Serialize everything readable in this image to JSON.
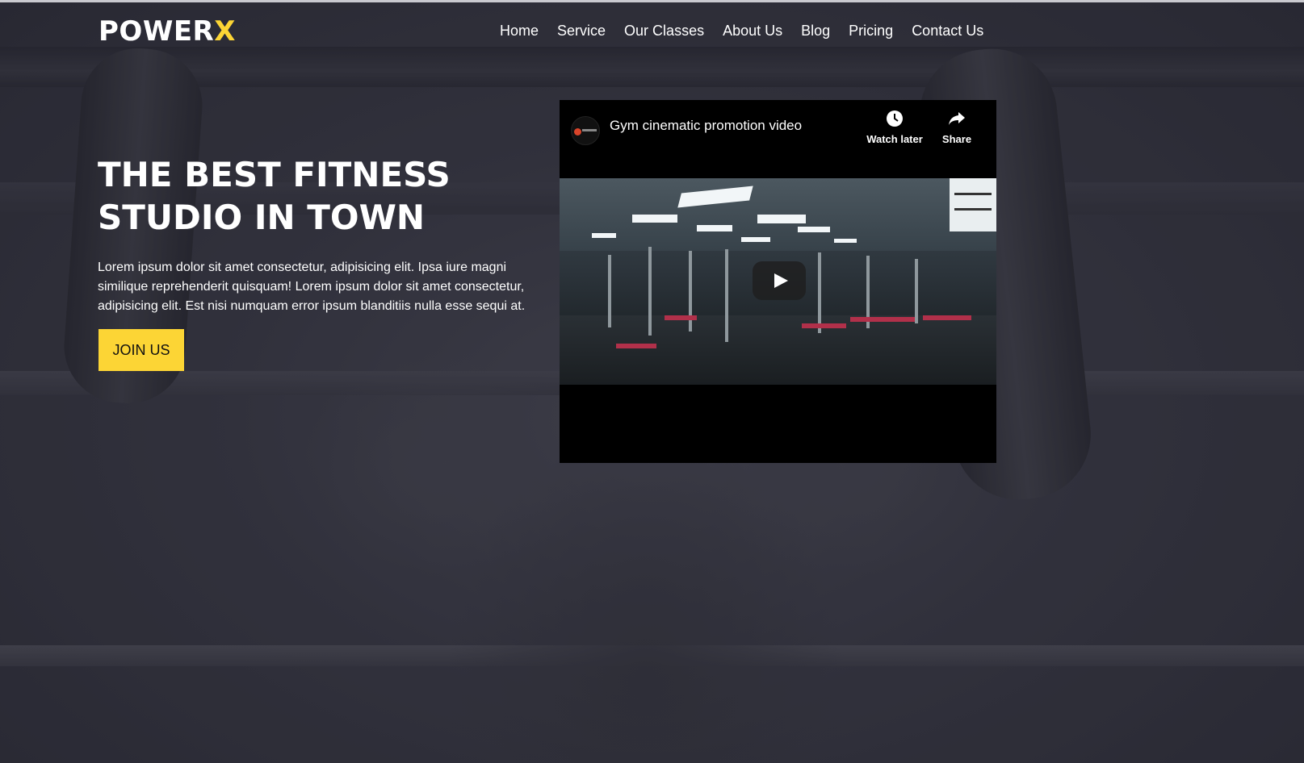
{
  "brand": {
    "name": "POWER",
    "accent": "X",
    "accent_color": "#fcd535"
  },
  "nav": {
    "items": [
      {
        "label": "Home"
      },
      {
        "label": "Service"
      },
      {
        "label": "Our Classes"
      },
      {
        "label": "About Us"
      },
      {
        "label": "Blog"
      },
      {
        "label": "Pricing"
      },
      {
        "label": "Contact Us"
      }
    ]
  },
  "hero": {
    "title_line1": "THE BEST FITNESS",
    "title_line2": "STUDIO IN TOWN",
    "description": "Lorem ipsum dolor sit amet consectetur, adipisicing elit. Ipsa iure magni similique reprehenderit quisquam! Lorem ipsum dolor sit amet consectetur, adipisicing elit. Est nisi numquam error ipsum blanditiis nulla esse sequi at.",
    "cta_label": "JOIN US"
  },
  "video": {
    "title": "Gym cinematic promotion video",
    "watch_later_label": "Watch later",
    "share_label": "Share",
    "icons": {
      "watch_later": "clock-icon",
      "share": "share-arrow-icon",
      "play": "play-icon"
    }
  },
  "colors": {
    "accent": "#fcd535",
    "background": "#3a3a45",
    "video_bg": "#000000"
  }
}
